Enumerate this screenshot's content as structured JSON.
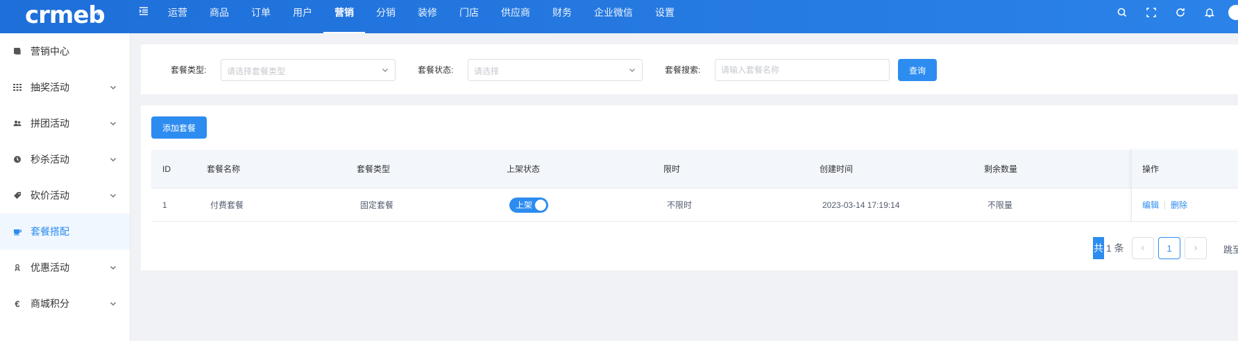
{
  "app": {
    "logo_text": "crmeb"
  },
  "topnav": {
    "items": [
      {
        "label": "运营"
      },
      {
        "label": "商品"
      },
      {
        "label": "订单"
      },
      {
        "label": "用户"
      },
      {
        "label": "营销",
        "active": true
      },
      {
        "label": "分销"
      },
      {
        "label": "装修"
      },
      {
        "label": "门店"
      },
      {
        "label": "供应商"
      },
      {
        "label": "财务"
      },
      {
        "label": "企业微信"
      },
      {
        "label": "设置"
      }
    ],
    "icons": [
      "search-icon",
      "fullscreen-icon",
      "refresh-icon",
      "bell-icon"
    ]
  },
  "sidebar": {
    "items": [
      {
        "label": "营销中心",
        "icon": "marketing-icon",
        "has_children": false
      },
      {
        "label": "抽奖活动",
        "icon": "grid-icon",
        "has_children": true
      },
      {
        "label": "拼团活动",
        "icon": "group-icon",
        "has_children": true
      },
      {
        "label": "秒杀活动",
        "icon": "clock-icon",
        "has_children": true
      },
      {
        "label": "砍价活动",
        "icon": "tag-icon",
        "has_children": true
      },
      {
        "label": "套餐搭配",
        "icon": "cup-icon",
        "has_children": false,
        "active": true
      },
      {
        "label": "优惠活动",
        "icon": "coupon-icon",
        "has_children": true
      },
      {
        "label": "商城积分",
        "icon": "euro-icon",
        "has_children": true
      }
    ]
  },
  "filters": {
    "type_label": "套餐类型:",
    "type_placeholder": "请选择套餐类型",
    "status_label": "套餐状态:",
    "status_placeholder": "请选择",
    "search_label": "套餐搜索:",
    "search_placeholder": "请输入套餐名称",
    "query_button": "查询"
  },
  "table": {
    "add_button": "添加套餐",
    "columns": [
      "ID",
      "套餐名称",
      "套餐类型",
      "上架状态",
      "限时",
      "创建时间",
      "剩余数量",
      "操作"
    ],
    "rows": [
      {
        "id": "1",
        "name": "付费套餐",
        "type": "固定套餐",
        "status_label": "上架",
        "status_on": true,
        "limit": "不限时",
        "created": "2023-03-14 17:19:14",
        "remaining": "不限量",
        "actions": [
          "编辑",
          "删除"
        ]
      }
    ]
  },
  "pagination": {
    "total_prefix": "共",
    "total_suffix": "1 条",
    "current_page": "1",
    "jump_label": "跳至"
  },
  "colors": {
    "primary": "#2d8cf0",
    "header_start": "#1e6fd9",
    "header_end": "#2b82e8"
  }
}
